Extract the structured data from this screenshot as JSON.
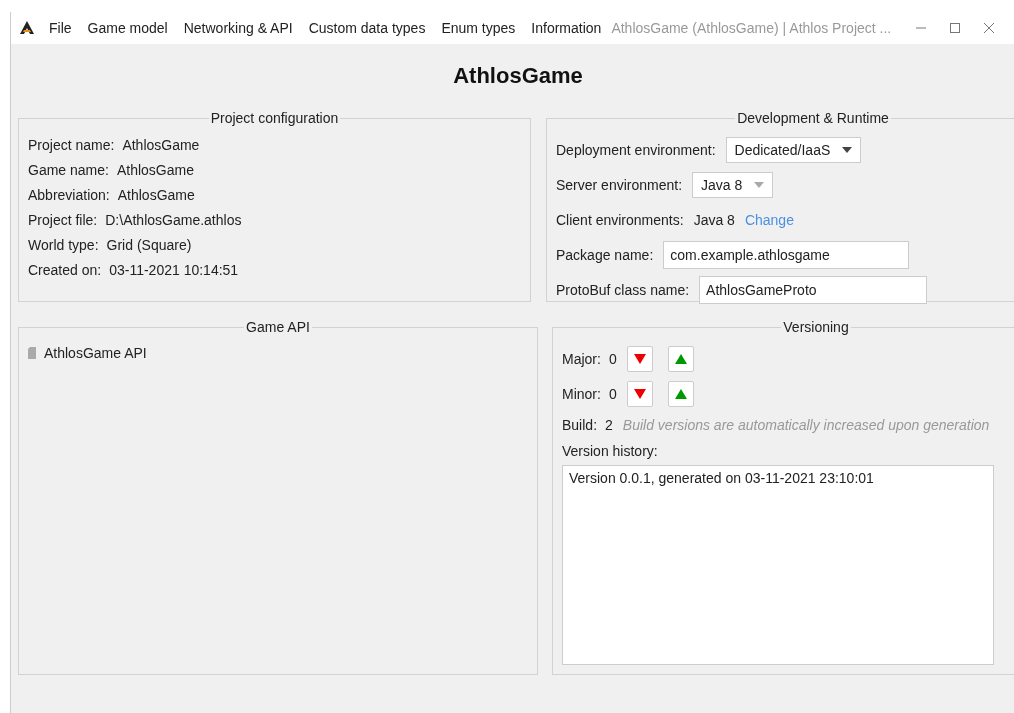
{
  "menu": [
    "File",
    "Game model",
    "Networking & API",
    "Custom data types",
    "Enum types",
    "Information"
  ],
  "window": {
    "title": "AthlosGame (AthlosGame) | Athlos Project ..."
  },
  "heading": "AthlosGame",
  "project_configuration": {
    "title": "Project configuration",
    "fields": [
      {
        "label": "Project name:",
        "value": "AthlosGame"
      },
      {
        "label": "Game name:",
        "value": "AthlosGame"
      },
      {
        "label": "Abbreviation:",
        "value": "AthlosGame"
      },
      {
        "label": "Project file:",
        "value": "D:\\AthlosGame.athlos"
      },
      {
        "label": "World type:",
        "value": "Grid (Square)"
      },
      {
        "label": "Created on:",
        "value": "03-11-2021 10:14:51"
      }
    ]
  },
  "development_runtime": {
    "title": "Development & Runtime",
    "rows": [
      {
        "kind": "dropdown",
        "label": "Deployment environment:",
        "value": "Dedicated/IaaS",
        "disabled": false
      },
      {
        "kind": "dropdown",
        "label": "Server environment:",
        "value": "Java 8",
        "disabled": true
      },
      {
        "kind": "link",
        "label": "Client environments:",
        "value": "Java 8",
        "link": "Change"
      },
      {
        "kind": "input",
        "label": "Package name:",
        "value": "com.example.athlosgame"
      },
      {
        "kind": "input",
        "label": "ProtoBuf class name:",
        "value": "AthlosGameProto"
      }
    ]
  },
  "game_api": {
    "title": "Game API",
    "items": [
      {
        "label": "AthlosGame API"
      }
    ]
  },
  "versioning": {
    "title": "Versioning",
    "counters": [
      {
        "label": "Major:",
        "value": "0"
      },
      {
        "label": "Minor:",
        "value": "0"
      }
    ],
    "build": {
      "label": "Build:",
      "value": "2",
      "note": "Build versions are automatically increased upon generation"
    },
    "history_label": "Version history:",
    "history": [
      "Version 0.0.1, generated on 03-11-2021 23:10:01"
    ]
  }
}
